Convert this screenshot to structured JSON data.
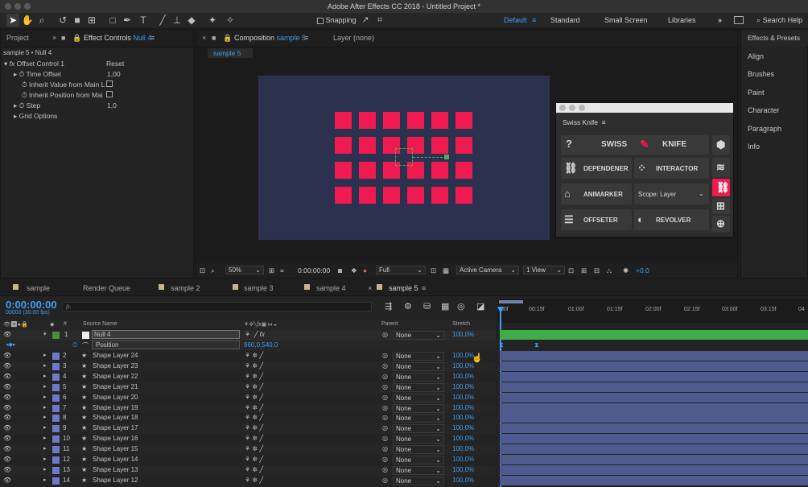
{
  "app": {
    "title": "Adobe After Effects CC 2018 - Untitled Project *"
  },
  "toolbar": {
    "snapping": "Snapping",
    "workspaces": [
      "Default",
      "Standard",
      "Small Screen",
      "Libraries"
    ],
    "search_help": "Search Help",
    "icons": [
      "selection-tool-icon",
      "hand-tool-icon",
      "zoom-tool-icon",
      "rotate-tool-icon",
      "camera-tool-icon",
      "pan-behind-tool-icon",
      "rectangle-tool-icon",
      "pen-tool-icon",
      "type-tool-icon",
      "brush-tool-icon",
      "stamp-tool-icon",
      "eraser-tool-icon",
      "roto-brush-tool-icon",
      "puppet-tool-icon"
    ]
  },
  "left_panel": {
    "tab_project": "Project",
    "tab_effect_prefix": "Effect Controls",
    "tab_effect_layer": "Null 4",
    "breadcrumb": "sample 5 • Null 4",
    "effect_name": "Offset Control 1",
    "reset": "Reset",
    "props": [
      {
        "name": "Time Offset",
        "value": "1,00"
      },
      {
        "name": "Inherit Value from Main L",
        "value": ""
      },
      {
        "name": "Inherit Position from Mai",
        "value": ""
      },
      {
        "name": "Step",
        "value": "1,0"
      },
      {
        "name": "Grid Options",
        "value": ""
      }
    ]
  },
  "comp_panel": {
    "tab_prefix": "Composition",
    "tab_comp": "sample 5",
    "tab_layer": "Layer (none)",
    "sub_tab": "sample 5",
    "zoom": "50%",
    "timecode": "0:00:00:00",
    "resolution": "Full",
    "camera": "Active Camera",
    "views": "1 View",
    "exposure": "+0,0"
  },
  "swiss_knife": {
    "title": "Swiss Knife",
    "help": "?",
    "swiss": "SWISS",
    "knife": "KNIFE",
    "dependener": "DEPENDENER",
    "interactor": "INTERACTOR",
    "animarker": "ANIMARKER",
    "scope": "Scope: Layer",
    "offseter": "OFFSETER",
    "revolver": "REVOLVER"
  },
  "right_panel": {
    "items": [
      "Effects & Presets",
      "Align",
      "Brushes",
      "Paint",
      "Character",
      "Paragraph",
      "Info"
    ]
  },
  "timeline": {
    "tabs": [
      "sample",
      "Render Queue",
      "sample 2",
      "sample 3",
      "sample 4",
      "sample 5"
    ],
    "timecode": "0:00:00:00",
    "fps": "00000 (30.00 fps)",
    "search_placeholder": "ρ.",
    "col_num": "#",
    "col_source": "Source Name",
    "col_parent": "Parent",
    "col_stretch": "Stretch",
    "ruler": [
      "00f",
      "00:15f",
      "01:00f",
      "01:15f",
      "02:00f",
      "02:15f",
      "03:00f",
      "03:15f",
      "04"
    ],
    "null_layer": {
      "num": "1",
      "name": "Null 4",
      "parent": "None",
      "stretch": "100,0%"
    },
    "position_label": "Position",
    "position_value": "960,0,540,0",
    "layers": [
      {
        "num": "2",
        "name": "Shape Layer 24",
        "parent": "None",
        "stretch": "100,0%"
      },
      {
        "num": "3",
        "name": "Shape Layer 23",
        "parent": "None",
        "stretch": "100,0%"
      },
      {
        "num": "4",
        "name": "Shape Layer 22",
        "parent": "None",
        "stretch": "100,0%"
      },
      {
        "num": "5",
        "name": "Shape Layer 21",
        "parent": "None",
        "stretch": "100,0%"
      },
      {
        "num": "6",
        "name": "Shape Layer 20",
        "parent": "None",
        "stretch": "100,0%"
      },
      {
        "num": "7",
        "name": "Shape Layer 19",
        "parent": "None",
        "stretch": "100,0%"
      },
      {
        "num": "8",
        "name": "Shape Layer 18",
        "parent": "None",
        "stretch": "100,0%"
      },
      {
        "num": "9",
        "name": "Shape Layer 17",
        "parent": "None",
        "stretch": "100,0%"
      },
      {
        "num": "10",
        "name": "Shape Layer 16",
        "parent": "None",
        "stretch": "100,0%"
      },
      {
        "num": "11",
        "name": "Shape Layer 15",
        "parent": "None",
        "stretch": "100,0%"
      },
      {
        "num": "12",
        "name": "Shape Layer 14",
        "parent": "None",
        "stretch": "100,0%"
      },
      {
        "num": "13",
        "name": "Shape Layer 13",
        "parent": "None",
        "stretch": "100,0%"
      },
      {
        "num": "14",
        "name": "Shape Layer 12",
        "parent": "None",
        "stretch": "100,0%"
      }
    ]
  },
  "colors": {
    "accent": "#3d9ef2",
    "shape": "#ef1a4f",
    "comp_bg": "#2d3150",
    "layer_label": "#6c79c9",
    "null_bar": "#3fae4a"
  }
}
